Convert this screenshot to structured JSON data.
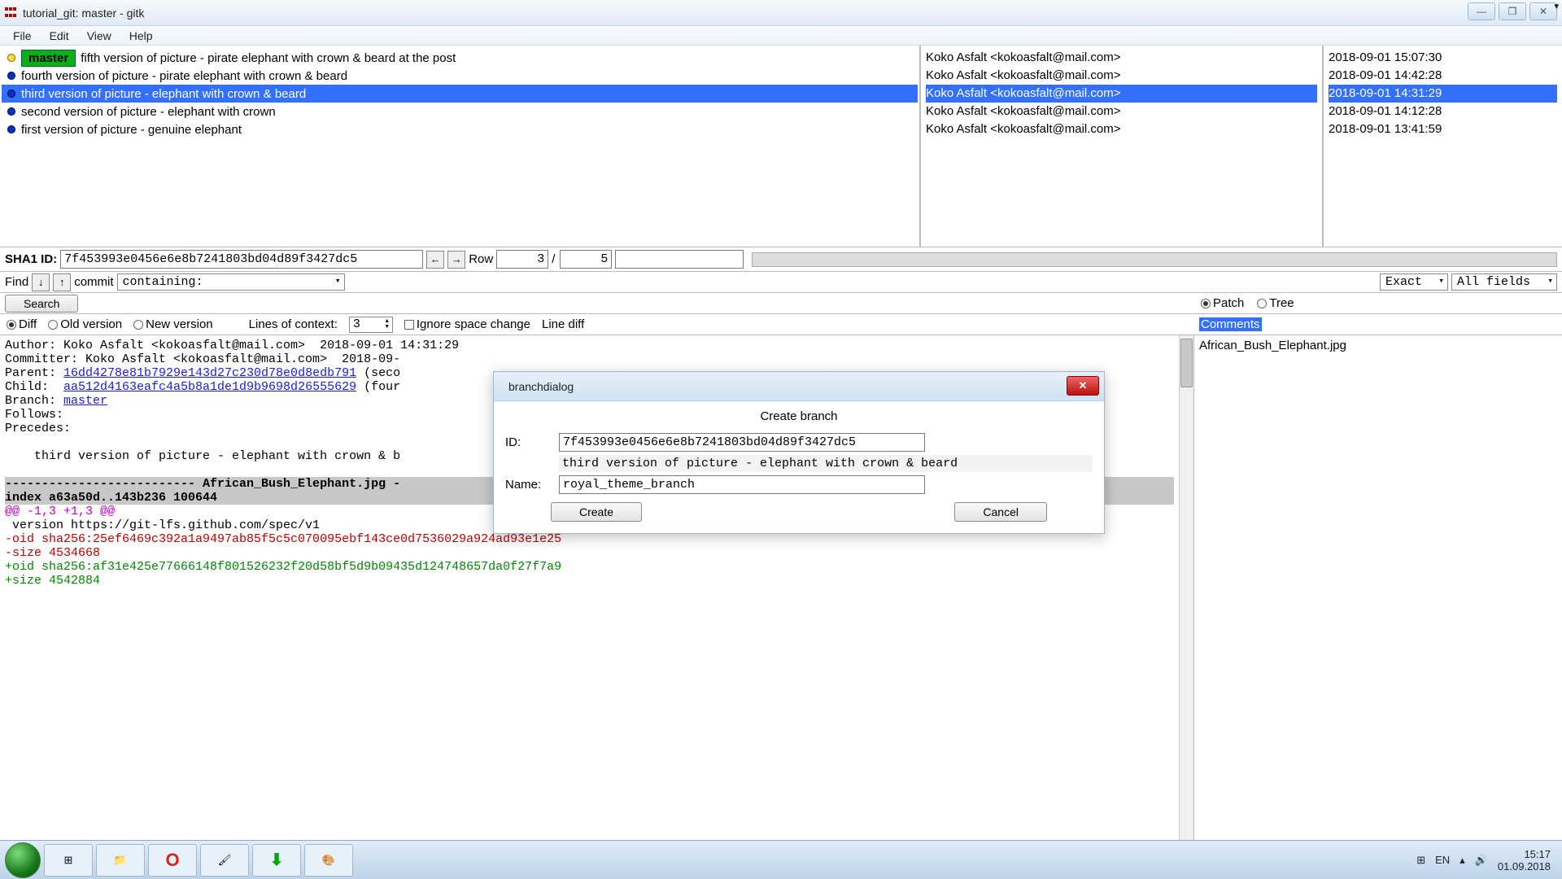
{
  "window": {
    "title": "tutorial_git: master - gitk"
  },
  "menubar": [
    "File",
    "Edit",
    "View",
    "Help"
  ],
  "commits": [
    {
      "branch": "master",
      "msg": "fifth version of picture - pirate elephant with crown & beard at the post",
      "author": "Koko Asfalt <kokoasfalt@mail.com>",
      "date": "2018-09-01 15:07:30",
      "head": true,
      "selected": false
    },
    {
      "branch": "",
      "msg": "fourth version of picture - pirate elephant with crown & beard",
      "author": "Koko Asfalt <kokoasfalt@mail.com>",
      "date": "2018-09-01 14:42:28",
      "head": false,
      "selected": false
    },
    {
      "branch": "",
      "msg": "third version of picture - elephant with crown & beard",
      "author": "Koko Asfalt <kokoasfalt@mail.com>",
      "date": "2018-09-01 14:31:29",
      "head": false,
      "selected": true
    },
    {
      "branch": "",
      "msg": "second version of picture - elephant with crown",
      "author": "Koko Asfalt <kokoasfalt@mail.com>",
      "date": "2018-09-01 14:12:28",
      "head": false,
      "selected": false
    },
    {
      "branch": "",
      "msg": "first version of picture - genuine elephant",
      "author": "Koko Asfalt <kokoasfalt@mail.com>",
      "date": "2018-09-01 13:41:59",
      "head": false,
      "selected": false
    }
  ],
  "sha": {
    "label": "SHA1 ID:",
    "value": "7f453993e0456e6e8b7241803bd04d89f3427dc5",
    "row_label": "Row",
    "row_current": "3",
    "row_sep": "/",
    "row_total": "5"
  },
  "find": {
    "label": "Find",
    "mode": "commit",
    "containing": "containing:",
    "match": "Exact",
    "fields": "All fields"
  },
  "search_btn": "Search",
  "filter": {
    "diff": "Diff",
    "old": "Old version",
    "new": "New version",
    "context_label": "Lines of context:",
    "context_value": "3",
    "ignore_space": "Ignore space change",
    "line_diff": "Line diff"
  },
  "detail": {
    "author_line": "Author: Koko Asfalt <kokoasfalt@mail.com>  2018-09-01 14:31:29",
    "committer_line": "Committer: Koko Asfalt <kokoasfalt@mail.com>  2018-09-",
    "parent_label": "Parent: ",
    "parent_sha": "16dd4278e81b7929e143d27c230d78e0d8edb791",
    "parent_suffix": " (seco",
    "child_label": "Child:  ",
    "child_sha": "aa512d4163eafc4a5b8a1de1d9b9698d26555629",
    "child_suffix": " (four",
    "branch_label": "Branch: ",
    "branch_link": "master",
    "follows": "Follows:",
    "precedes": "Precedes:",
    "commit_msg": "    third version of picture - elephant with crown & b",
    "hdr1": "-------------------------- African_Bush_Elephant.jpg -",
    "hdr2": "index a63a50d..143b236 100644",
    "hunk": "@@ -1,3 +1,3 @@",
    "l1": " version https://git-lfs.github.com/spec/v1",
    "l2": "-oid sha256:25ef6469c392a1a9497ab85f5c5c070095ebf143ce0d7536029a924ad93e1e25",
    "l3": "-size 4534668",
    "l4": "+oid sha256:af31e425e77666148f801526232f20d58bf5d9b09435d124748657da0f27f7a9",
    "l5": "+size 4542884"
  },
  "files": {
    "tab_patch": "Patch",
    "tab_tree": "Tree",
    "comments": "Comments",
    "file1": "African_Bush_Elephant.jpg"
  },
  "dialog": {
    "title": "branchdialog",
    "heading": "Create branch",
    "id_label": "ID:",
    "id_value": "7f453993e0456e6e8b7241803bd04d89f3427dc5",
    "desc": "third version of picture - elephant with crown & beard",
    "name_label": "Name:",
    "name_value": "royal_theme_branch",
    "create": "Create",
    "cancel": "Cancel"
  },
  "tray": {
    "lang": "EN",
    "time": "15:17",
    "date": "01.09.2018"
  }
}
